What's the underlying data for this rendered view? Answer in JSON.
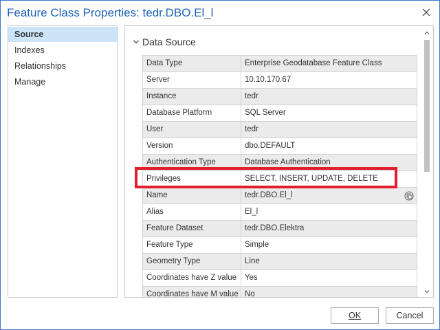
{
  "window": {
    "title": "Feature Class Properties: tedr.DBO.El_l",
    "close_icon": "close-icon"
  },
  "sidebar": {
    "items": [
      {
        "label": "Source",
        "selected": true
      },
      {
        "label": "Indexes",
        "selected": false
      },
      {
        "label": "Relationships",
        "selected": false
      },
      {
        "label": "Manage",
        "selected": false
      }
    ]
  },
  "section": {
    "title": "Data Source",
    "expand_icon": "chevron-down-icon"
  },
  "properties": [
    {
      "key": "Data Type",
      "value": "Enterprise Geodatabase Feature Class"
    },
    {
      "key": "Server",
      "value": "10.10.170.67"
    },
    {
      "key": "Instance",
      "value": "tedr"
    },
    {
      "key": "Database Platform",
      "value": "SQL Server"
    },
    {
      "key": "User",
      "value": "tedr"
    },
    {
      "key": "Version",
      "value": "dbo.DEFAULT"
    },
    {
      "key": "Authentication Type",
      "value": "Database Authentication"
    },
    {
      "key": "Privileges",
      "value": "SELECT, INSERT, UPDATE, DELETE"
    },
    {
      "key": "Name",
      "value": "tedr.DBO.El_l"
    },
    {
      "key": "Alias",
      "value": "El_l"
    },
    {
      "key": "Feature Dataset",
      "value": "tedr.DBO.Elektra"
    },
    {
      "key": "Feature Type",
      "value": "Simple"
    },
    {
      "key": "Geometry Type",
      "value": "Line"
    },
    {
      "key": "Coordinates have Z value",
      "value": "Yes"
    },
    {
      "key": "Coordinates have M value",
      "value": "No"
    }
  ],
  "buttons": {
    "ok": "OK",
    "cancel": "Cancel"
  },
  "colors": {
    "title": "#1e64b4",
    "selected_bg": "#cce4f7",
    "highlight": "#e01e2d",
    "alt_row": "#ebebeb"
  }
}
